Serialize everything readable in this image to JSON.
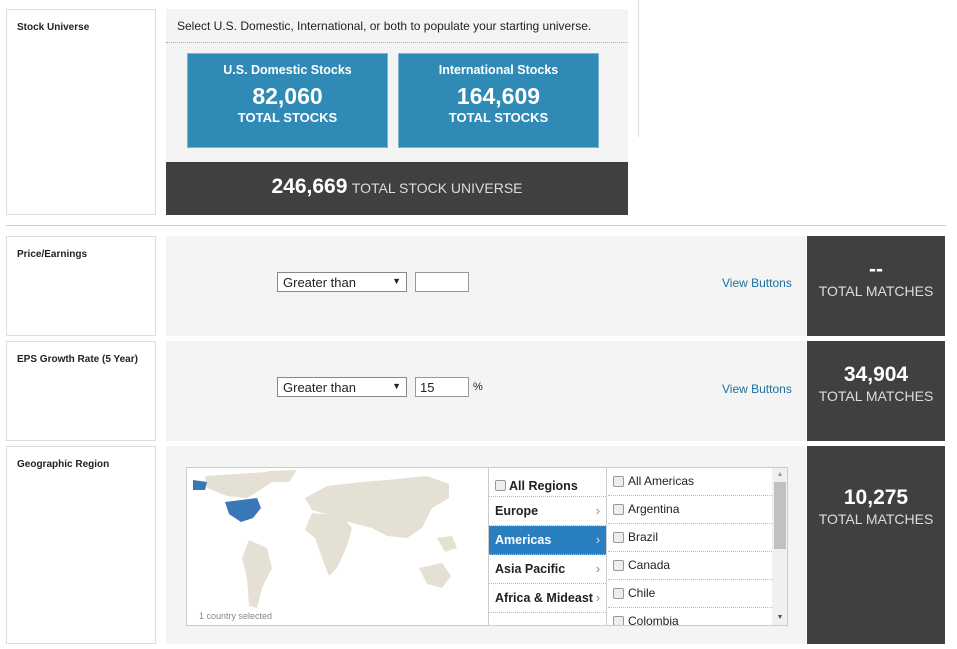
{
  "universe": {
    "label": "Stock Universe",
    "instructions": "Select U.S. Domestic, International, or both to populate your starting universe.",
    "domestic": {
      "title": "U.S. Domestic Stocks",
      "count": "82,060",
      "sub": "TOTAL STOCKS"
    },
    "international": {
      "title": "International Stocks",
      "count": "164,609",
      "sub": "TOTAL STOCKS"
    },
    "total": {
      "count": "246,669",
      "sub": "TOTAL STOCK UNIVERSE"
    }
  },
  "pe": {
    "label": "Price/Earnings",
    "operator": "Greater than",
    "value": "",
    "view_buttons": "View Buttons",
    "matches": "--",
    "matches_label": "TOTAL MATCHES"
  },
  "eps": {
    "label": "EPS Growth Rate (5 Year)",
    "operator": "Greater than",
    "value": "15",
    "unit": "%",
    "view_buttons": "View Buttons",
    "matches": "34,904",
    "matches_label": "TOTAL MATCHES"
  },
  "geo": {
    "label": "Geographic Region",
    "map_status": "1 country selected",
    "selected_color": "#3a78b5",
    "map_color": "#e4e0d3",
    "regions": [
      {
        "label": "All Regions",
        "checkbox": true
      },
      {
        "label": "Europe"
      },
      {
        "label": "Americas",
        "active": true
      },
      {
        "label": "Asia Pacific"
      },
      {
        "label": "Africa & Mideast"
      }
    ],
    "countries": [
      "All Americas",
      "Argentina",
      "Brazil",
      "Canada",
      "Chile",
      "Colombia"
    ],
    "matches": "10,275",
    "matches_label": "TOTAL MATCHES"
  }
}
